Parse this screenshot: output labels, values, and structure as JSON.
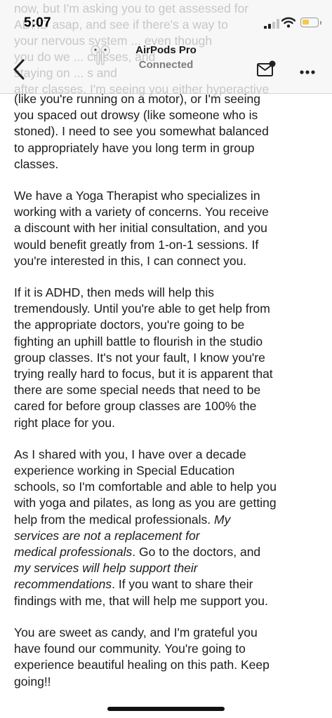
{
  "status_bar": {
    "time": "5:07"
  },
  "header": {
    "device_name": "AirPods Pro",
    "device_status": "Connected",
    "background_text_lines": [
      "now, but I'm asking you to get assessed for",
      "ADHD asap, and see if there's a way to",
      "your nervous system ... even though",
      "you do we ... classes, and",
      "staying on ... s and",
      "after classes. I'm seeing you either hyperactive"
    ]
  },
  "message": {
    "paragraphs": [
      {
        "lines": [
          "(like you're running on a motor), or I'm seeing",
          "you spaced out drowsy (like someone who is",
          "stoned). I need to see you somewhat balanced",
          "to appropriately have you long term in group",
          "classes."
        ]
      },
      {
        "lines": [
          "We have a Yoga Therapist who specializes in",
          "working with a variety of concerns. You receive",
          "a discount with her initial consultation, and you",
          "would benefit greatly from 1-on-1 sessions. If",
          "you're interested in this, I can connect you."
        ]
      },
      {
        "lines": [
          "If it is ADHD, then meds will help this",
          "tremendously. Until you're able to get help from",
          "the appropriate doctors, you're going to be",
          "fighting an uphill battle to flourish in the studio",
          "group classes. It's not your fault, I know you're",
          "trying really hard to focus, but it is apparent that",
          "there are some special needs that need to be",
          "cared for before group classes are 100% the",
          "right place for you."
        ]
      },
      {
        "lines_mixed": [
          [
            "As I shared with you, I have over a decade"
          ],
          [
            "experience working in Special Education"
          ],
          [
            "schools, so I'm comfortable and able to help you"
          ],
          [
            "with yoga and pilates, as long as you are getting"
          ],
          [
            "help from the medical professionals. ",
            "My"
          ],
          [
            "services are not a replacement for"
          ],
          [
            "medical professionals",
            ". Go to the doctors, and"
          ],
          [
            "my services will help support their"
          ],
          [
            "recommendations",
            ". If you want to share their"
          ],
          [
            "findings with me, that will help me support you."
          ]
        ]
      },
      {
        "lines": [
          "You are sweet as candy, and I'm grateful you",
          "have found our community. You're going to",
          "experience beautiful healing on this path. Keep",
          "going!!"
        ]
      }
    ]
  },
  "colors": {
    "battery": "#f4c84a",
    "muted_text": "#7d7d7d",
    "body_text": "#1c1c1c"
  },
  "icons": [
    "signal-icon",
    "wifi-icon",
    "battery-icon",
    "back-chevron-icon",
    "airpods-icon",
    "mail-unread-icon",
    "more-icon"
  ]
}
